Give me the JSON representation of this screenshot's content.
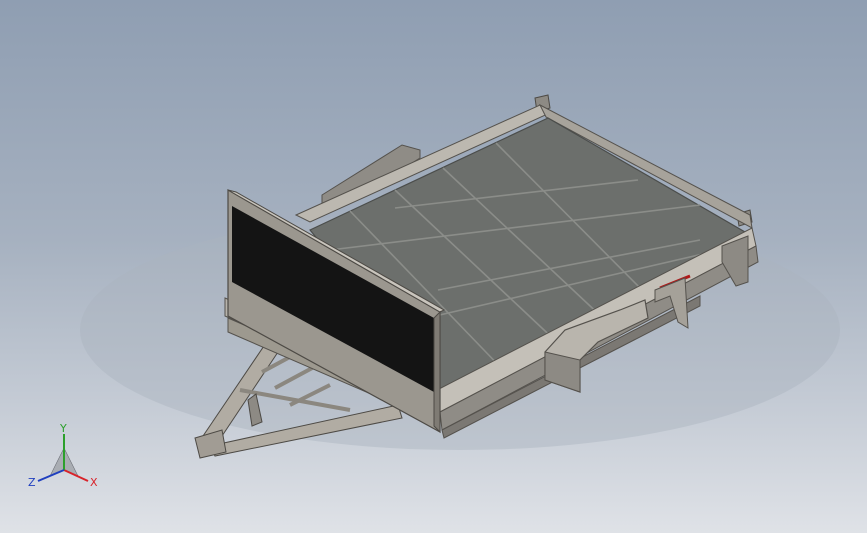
{
  "triad": {
    "x_label": "X",
    "y_label": "Y",
    "z_label": "Z",
    "x_color": "#d8232a",
    "y_color": "#2ca02c",
    "z_color": "#1f3fbf"
  },
  "model": {
    "body_color": "#9a968d",
    "deck_color": "#6c6f6c",
    "drawbar_color": "#b1aca3",
    "board_color": "#141414",
    "accent_color": "#b01818"
  }
}
